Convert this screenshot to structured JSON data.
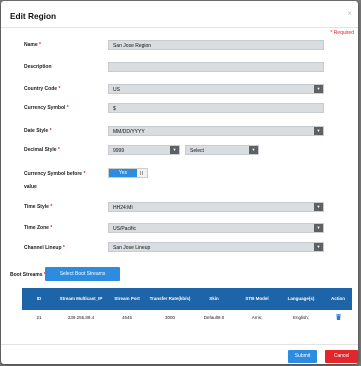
{
  "dialog": {
    "title": "Edit Region",
    "required_note": "* Required",
    "close_glyph": "×"
  },
  "fields": {
    "name": {
      "label": "Name",
      "value": "San Jose Region"
    },
    "description": {
      "label": "Description",
      "value": ""
    },
    "country_code": {
      "label": "Country Code",
      "value": "US"
    },
    "currency_symbol": {
      "label": "Currency Symbol",
      "value": "$"
    },
    "date_style": {
      "label": "Date Style",
      "value": "MM/DD/YYYY"
    },
    "decimal_style": {
      "label": "Decimal Style",
      "value": "9999",
      "value2": "Select"
    },
    "currency_before": {
      "label_line1": "Currency Symbol before",
      "label_line2": "value",
      "toggle": "Yes"
    },
    "time_style": {
      "label": "Time Style",
      "value": "HH24:MI"
    },
    "time_zone": {
      "label": "Time Zone",
      "value": "US/Pacific"
    },
    "channel_lineup": {
      "label": "Channel Lineup",
      "value": "San Jose Lineup"
    }
  },
  "boot_streams": {
    "label": "Boot Streams",
    "button": "Select Boot Streams",
    "columns": [
      "ID",
      "Stream Multicast_IP",
      "Stream Port",
      "Transfer Rate(kb/s)",
      "Skin",
      "STB Model",
      "Language(s)",
      "Action"
    ],
    "rows": [
      [
        "21",
        "239.255.89.4",
        "4545",
        "3000",
        "Default8.0",
        "Arris;",
        "English;"
      ]
    ]
  },
  "footer": {
    "submit": "Submit",
    "cancel": "Cancel"
  }
}
